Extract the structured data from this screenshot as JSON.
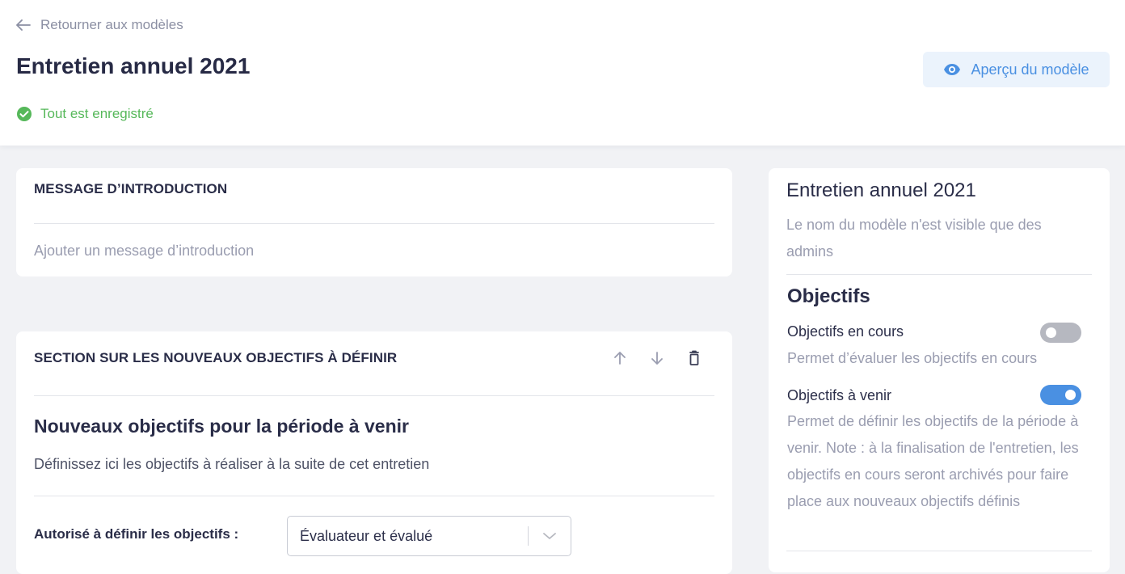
{
  "header": {
    "back_label": "Retourner aux modèles",
    "title": "Entretien annuel 2021",
    "save_status": "Tout est enregistré",
    "preview_button": "Aperçu du modèle"
  },
  "intro": {
    "title": "MESSAGE D’INTRODUCTION",
    "placeholder": "Ajouter un message d’introduction"
  },
  "section": {
    "title": "SECTION SUR LES NOUVEAUX OBJECTIFS À DÉFINIR",
    "heading": "Nouveaux objectifs pour la période à venir",
    "description": "Définissez ici les objectifs à réaliser à la suite de cet entretien",
    "allowed_label": "Autorisé à définir les objectifs :",
    "allowed_value": "Évaluateur et évalué"
  },
  "sidebar": {
    "title": "Entretien annuel 2021",
    "note": "Le nom du modèle n'est visible que des admins",
    "objectives_heading": "Objectifs",
    "options": [
      {
        "label": "Objectifs en cours",
        "description": "Permet d’évaluer les objectifs en cours",
        "enabled": false
      },
      {
        "label": "Objectifs à venir",
        "description": "Permet de définir les objectifs de la période à venir. Note : à la finalisation de l'entretien, les objectifs en cours seront archivés pour faire place aux nouveaux objectifs définis",
        "enabled": true
      }
    ]
  },
  "colors": {
    "accent": "#4a90e2",
    "success": "#56b85a",
    "toggle_off": "#b6b8c0"
  },
  "icons": {
    "back": "arrow-left-icon",
    "saved": "check-circle-icon",
    "preview": "eye-icon",
    "move_up": "arrow-up-icon",
    "move_down": "arrow-down-icon",
    "delete": "trash-icon",
    "select": "chevron-down-icon"
  }
}
